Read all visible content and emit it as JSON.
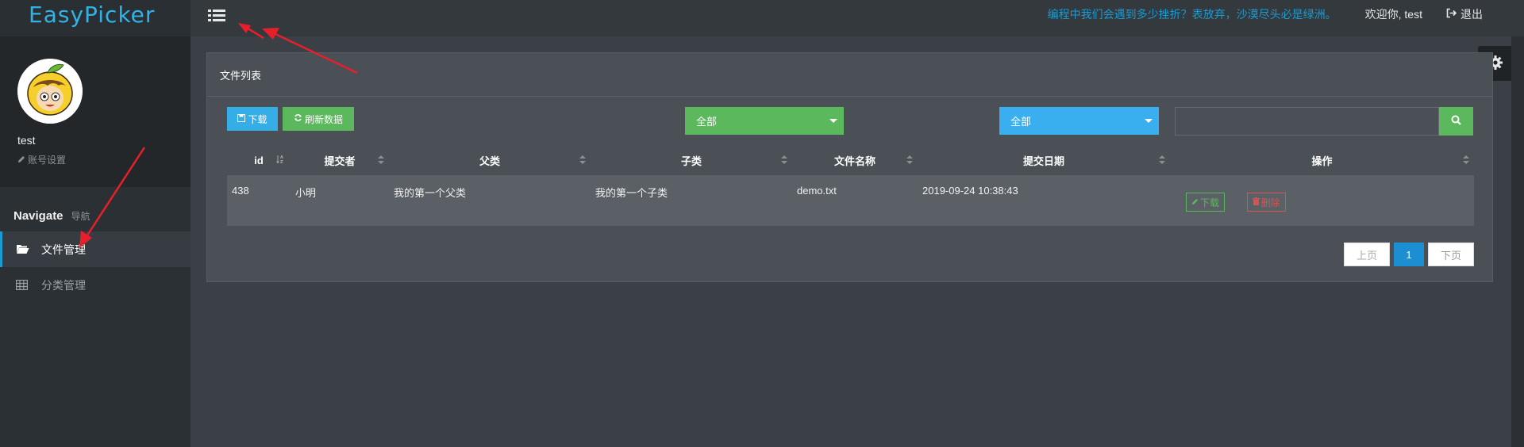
{
  "brand": {
    "logo": "EasyPicker"
  },
  "header": {
    "motto": "编程中我们会遇到多少挫折？表放弃，沙漠尽头必是绿洲。",
    "welcome": "欢迎你, test",
    "logout": "退出"
  },
  "sidebar": {
    "username": "test",
    "account_settings": "账号设置",
    "nav_title": "Navigate",
    "nav_subtitle": "导航",
    "items": [
      {
        "label": "文件管理",
        "icon": "folder-open-icon",
        "active": true
      },
      {
        "label": "分类管理",
        "icon": "table-icon",
        "active": false
      }
    ]
  },
  "panel": {
    "title": "文件列表",
    "download_button": "下载",
    "refresh_button": "刷新数据",
    "parent_filter": "全部",
    "child_filter": "全部",
    "search_placeholder": ""
  },
  "table": {
    "columns": [
      "id",
      "提交者",
      "父类",
      "子类",
      "文件名称",
      "提交日期",
      "操作"
    ],
    "rows": [
      {
        "id": "438",
        "submitter": "小明",
        "parent": "我的第一个父类",
        "child": "我的第一个子类",
        "filename": "demo.txt",
        "date": "2019-09-24 10:38:43",
        "action_download": "下载",
        "action_delete": "删除"
      }
    ]
  },
  "pagination": {
    "prev": "上页",
    "current": "1",
    "next": "下页"
  },
  "colors": {
    "accent": "#1b9bd1",
    "success": "#5cb85c",
    "info": "#3aaff0",
    "danger": "#d9534f"
  }
}
